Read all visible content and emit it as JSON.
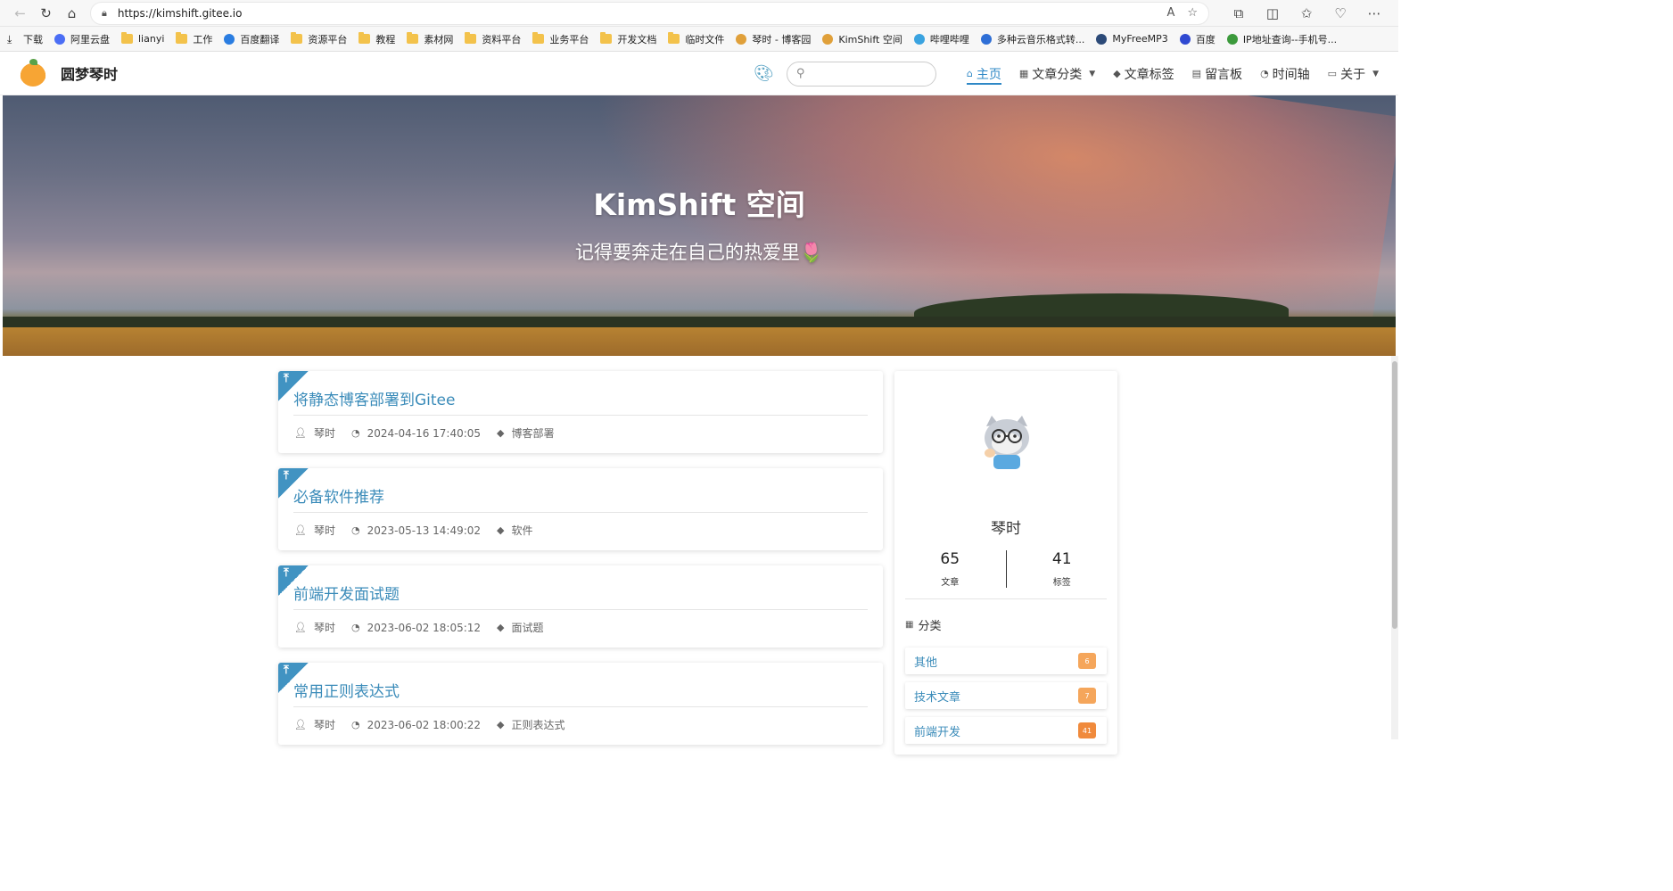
{
  "browser": {
    "url": "https://kimshift.gitee.io",
    "bookmarks": [
      {
        "label": "下载",
        "icon": "download-icon"
      },
      {
        "label": "阿里云盘",
        "icon": "aliyun-icon"
      },
      {
        "label": "lianyi",
        "icon": "folder-icon"
      },
      {
        "label": "工作",
        "icon": "folder-icon"
      },
      {
        "label": "百度翻译",
        "icon": "translate-icon"
      },
      {
        "label": "资源平台",
        "icon": "folder-icon"
      },
      {
        "label": "教程",
        "icon": "folder-icon"
      },
      {
        "label": "素材网",
        "icon": "folder-icon"
      },
      {
        "label": "资料平台",
        "icon": "folder-icon"
      },
      {
        "label": "业务平台",
        "icon": "folder-icon"
      },
      {
        "label": "开发文档",
        "icon": "folder-icon"
      },
      {
        "label": "临时文件",
        "icon": "folder-icon"
      },
      {
        "label": "琴时 - 博客园",
        "icon": "site-icon"
      },
      {
        "label": "KimShift 空间",
        "icon": "site-icon"
      },
      {
        "label": "哔哩哔哩",
        "icon": "bilibili-icon"
      },
      {
        "label": "多种云音乐格式转...",
        "icon": "music-icon"
      },
      {
        "label": "MyFreeMP3",
        "icon": "mp3-icon"
      },
      {
        "label": "百度",
        "icon": "baidu-icon"
      },
      {
        "label": "IP地址查询--手机号...",
        "icon": "ip-icon"
      }
    ]
  },
  "header": {
    "site_title": "圆梦琴时",
    "search_placeholder": "",
    "nav": [
      {
        "label": "主页",
        "icon": "home-icon",
        "active": true,
        "caret": false
      },
      {
        "label": "文章分类",
        "icon": "grid-icon",
        "active": false,
        "caret": true
      },
      {
        "label": "文章标签",
        "icon": "tag-icon",
        "active": false,
        "caret": false
      },
      {
        "label": "留言板",
        "icon": "board-icon",
        "active": false,
        "caret": false
      },
      {
        "label": "时间轴",
        "icon": "clock-icon",
        "active": false,
        "caret": false
      },
      {
        "label": "关于",
        "icon": "chat-icon",
        "active": false,
        "caret": true
      }
    ]
  },
  "hero": {
    "title": "KimShift 空间",
    "subtitle": "记得要奔走在自己的热爱里🌷"
  },
  "posts": [
    {
      "title": "将静态博客部署到Gitee",
      "author": "琴时",
      "date": "2024-04-16 17:40:05",
      "tag": "博客部署"
    },
    {
      "title": "必备软件推荐",
      "author": "琴时",
      "date": "2023-05-13 14:49:02",
      "tag": "软件"
    },
    {
      "title": "前端开发面试题",
      "author": "琴时",
      "date": "2023-06-02 18:05:12",
      "tag": "面试题"
    },
    {
      "title": "常用正则表达式",
      "author": "琴时",
      "date": "2023-06-02 18:00:22",
      "tag": "正则表达式"
    }
  ],
  "sidebar": {
    "author": "琴时",
    "stats": [
      {
        "num": "65",
        "label": "文章"
      },
      {
        "num": "41",
        "label": "标签"
      }
    ],
    "category_heading": "分类",
    "categories": [
      {
        "label": "其他",
        "count": "6",
        "color": "#f5a65b"
      },
      {
        "label": "技术文章",
        "count": "7",
        "color": "#f5a65b"
      },
      {
        "label": "前端开发",
        "count": "41",
        "color": "#f08a3c"
      }
    ]
  },
  "colors": {
    "accent": "#2f88c6",
    "link": "#3a8bb9",
    "pin": "#4193c2"
  }
}
